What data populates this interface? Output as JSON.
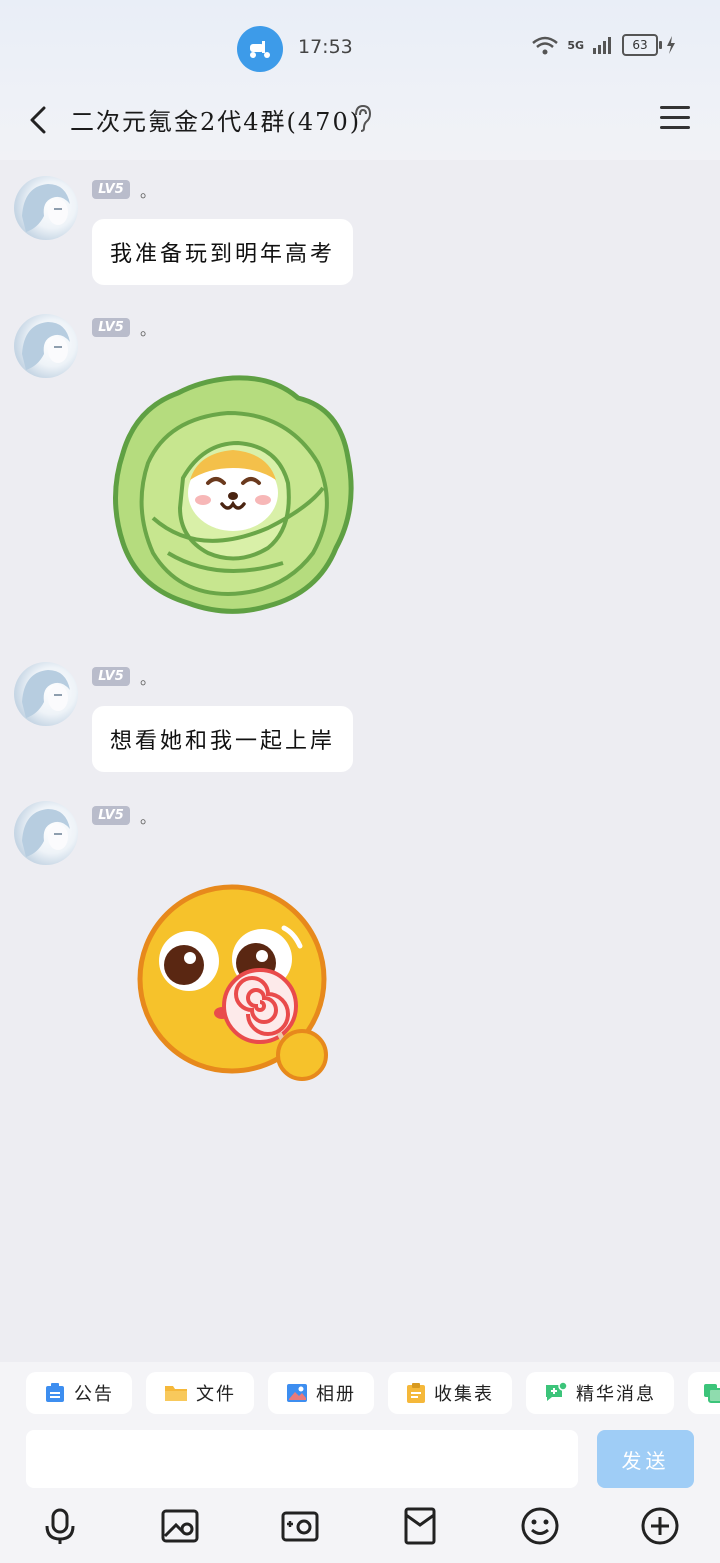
{
  "status_bar": {
    "time": "17:53",
    "network": "5G",
    "battery": "63"
  },
  "header": {
    "title": "二次元氪金2代4群(470)"
  },
  "messages": [
    {
      "level": "LV5",
      "nickname": "。",
      "type": "text",
      "text": "我准备玩到明年高考"
    },
    {
      "level": "LV5",
      "nickname": "。",
      "type": "sticker",
      "sticker": "cabbage-dog-sticker"
    },
    {
      "level": "LV5",
      "nickname": "。",
      "type": "text",
      "text": "想看她和我一起上岸"
    },
    {
      "level": "LV5",
      "nickname": "。",
      "type": "sticker",
      "sticker": "lollipop-emoji-sticker"
    }
  ],
  "quick_actions": [
    "公告",
    "文件",
    "相册",
    "收集表",
    "精华消息"
  ],
  "composer": {
    "send_label": "发送"
  },
  "toolbar_icons": [
    "microphone-icon",
    "image-icon",
    "camera-icon",
    "red-packet-icon",
    "emoji-icon",
    "plus-icon"
  ]
}
